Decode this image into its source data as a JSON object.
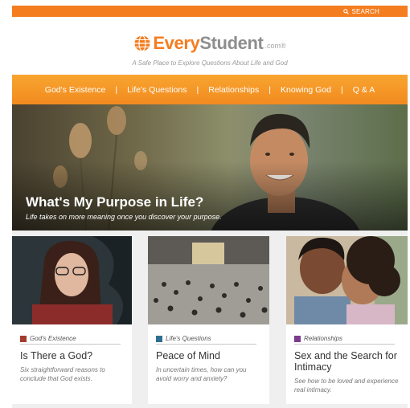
{
  "topbar": {
    "search_label": "SEARCH"
  },
  "header": {
    "logo": {
      "every": "Every",
      "student": "Student",
      "com": ".com®"
    },
    "tagline": "A Safe Place to Explore Questions About Life and God"
  },
  "nav": {
    "items": [
      {
        "label": "God's Existence"
      },
      {
        "label": "Life's Questions"
      },
      {
        "label": "Relationships"
      },
      {
        "label": "Knowing God"
      },
      {
        "label": "Q & A"
      }
    ],
    "separator": "|"
  },
  "hero": {
    "title": "What's My Purpose in Life?",
    "subtitle": "Life takes on more meaning once you discover your purpose."
  },
  "cards": [
    {
      "category": "God's Existence",
      "category_color": "#a33b2f",
      "title": "Is There a God?",
      "description": "Six straightforward reasons to conclude that God exists."
    },
    {
      "category": "Life's Questions",
      "category_color": "#2f6f92",
      "title": "Peace of Mind",
      "description": "In uncertain times, how can you avoid worry and anxiety?"
    },
    {
      "category": "Relationships",
      "category_color": "#7b3c8c",
      "title": "Sex and the Search for Intimacy",
      "description": "See how to be loved and experience real intimacy."
    }
  ],
  "colors": {
    "brand_orange": "#f47d20",
    "nav_top": "#f8a530",
    "nav_bottom": "#f28a1f",
    "logo_gray": "#8e8e8e"
  },
  "icons": [
    "search-icon",
    "globe-logo-icon"
  ]
}
